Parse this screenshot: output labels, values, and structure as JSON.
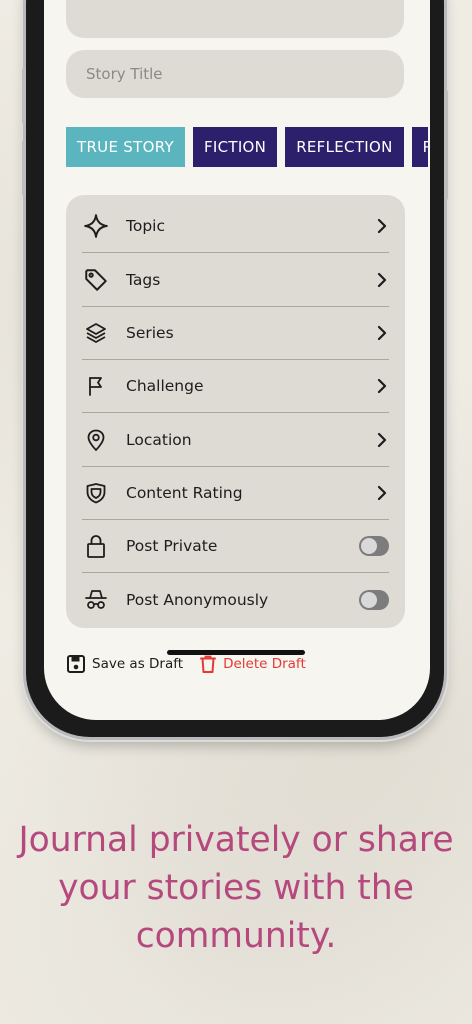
{
  "form": {
    "title_placeholder": "Story Title"
  },
  "categories": [
    {
      "label": "TRUE STORY",
      "selected": true
    },
    {
      "label": "FICTION",
      "selected": false
    },
    {
      "label": "REFLECTION",
      "selected": false
    },
    {
      "label": "PO",
      "selected": false
    }
  ],
  "menu": {
    "items": [
      {
        "label": "Topic",
        "icon": "sparkle-icon",
        "control": "chevron"
      },
      {
        "label": "Tags",
        "icon": "tag-icon",
        "control": "chevron"
      },
      {
        "label": "Series",
        "icon": "layers-icon",
        "control": "chevron"
      },
      {
        "label": "Challenge",
        "icon": "flag-icon",
        "control": "chevron"
      },
      {
        "label": "Location",
        "icon": "location-pin-icon",
        "control": "chevron"
      },
      {
        "label": "Content Rating",
        "icon": "shield-icon",
        "control": "chevron"
      },
      {
        "label": "Post Private",
        "icon": "lock-icon",
        "control": "toggle",
        "on": false
      },
      {
        "label": "Post Anonymously",
        "icon": "incognito-icon",
        "control": "toggle",
        "on": false
      }
    ]
  },
  "footer": {
    "save_label": "Save as Draft",
    "delete_label": "Delete Draft"
  },
  "caption": {
    "line1": "Journal privately or share",
    "line2": "your stories with the",
    "line3": "community."
  },
  "colors": {
    "accent_teal": "#5bb5bf",
    "chip_navy": "#2c1f6b",
    "delete_red": "#e53935",
    "caption_pink": "#b5497e"
  }
}
